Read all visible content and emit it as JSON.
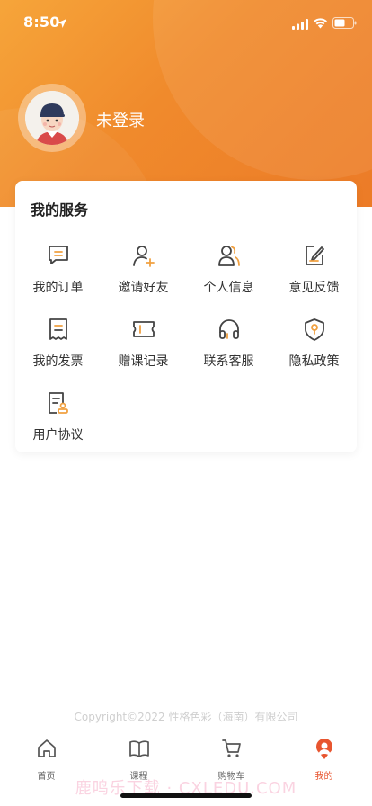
{
  "status_bar": {
    "time": "8:50"
  },
  "profile": {
    "login_label": "未登录"
  },
  "services": {
    "title": "我的服务",
    "items": [
      {
        "label": "我的订单",
        "icon": "order-icon"
      },
      {
        "label": "邀请好友",
        "icon": "invite-friend-icon"
      },
      {
        "label": "个人信息",
        "icon": "profile-icon"
      },
      {
        "label": "意见反馈",
        "icon": "feedback-icon"
      },
      {
        "label": "我的发票",
        "icon": "invoice-icon"
      },
      {
        "label": "赠课记录",
        "icon": "gift-ticket-icon"
      },
      {
        "label": "联系客服",
        "icon": "headset-icon"
      },
      {
        "label": "隐私政策",
        "icon": "privacy-shield-icon"
      },
      {
        "label": "用户协议",
        "icon": "agreement-icon"
      }
    ]
  },
  "footer": {
    "copyright": "Copyright©2022 性格色彩（海南）有限公司"
  },
  "tabbar": {
    "items": [
      {
        "label": "首页",
        "icon": "home-icon"
      },
      {
        "label": "课程",
        "icon": "book-icon"
      },
      {
        "label": "购物车",
        "icon": "cart-icon"
      },
      {
        "label": "我的",
        "icon": "mine-icon",
        "active": true
      }
    ]
  },
  "watermark": "鹿鸣乐下载 · CXLEDU.COM",
  "colors": {
    "accent": "#f08a2c",
    "active_tab": "#e8552f",
    "icon_highlight": "#f0a040"
  }
}
